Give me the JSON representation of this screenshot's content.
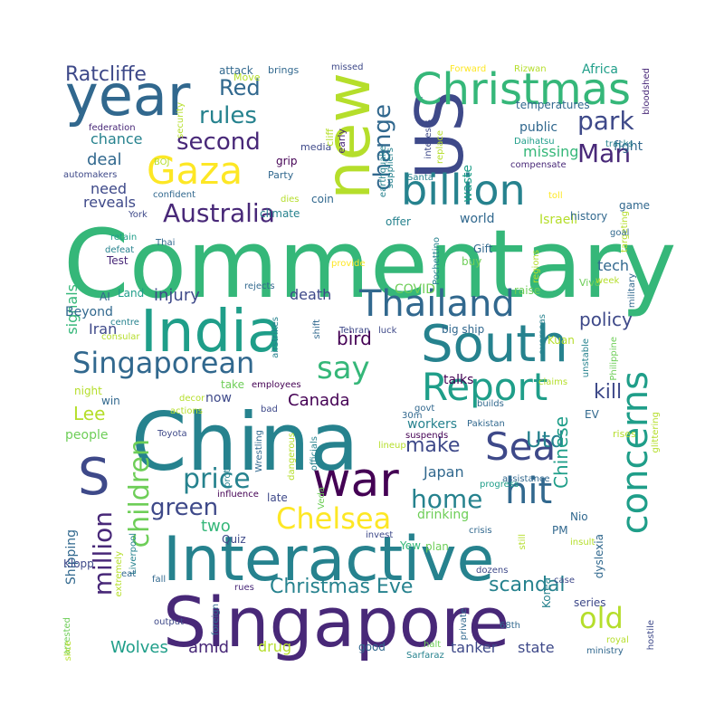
{
  "background": "#ffffff",
  "palette": {
    "d1": "#440154",
    "d2": "#482878",
    "d3": "#3e4989",
    "d4": "#31688e",
    "m1": "#26828e",
    "m2": "#1f9e89",
    "m3": "#35b779",
    "l1": "#6ece58",
    "l2": "#b5de2b",
    "l3": "#fde725"
  },
  "words": [
    {
      "text": "Commentary",
      "color": "#35b779"
    },
    {
      "text": "China",
      "color": "#26828e"
    },
    {
      "text": "Singapore",
      "color": "#482878"
    },
    {
      "text": "Interactive",
      "color": "#26828e"
    },
    {
      "text": "India",
      "color": "#1f9e89"
    },
    {
      "text": "US",
      "color": "#3e4989"
    },
    {
      "text": "new",
      "color": "#b5de2b"
    },
    {
      "text": "year",
      "color": "#31688e"
    },
    {
      "text": "South",
      "color": "#26828e"
    },
    {
      "text": "war",
      "color": "#440154"
    },
    {
      "text": "Christmas",
      "color": "#35b779"
    },
    {
      "text": "billion",
      "color": "#26828e"
    },
    {
      "text": "Report",
      "color": "#1f9e89"
    },
    {
      "text": "Sea",
      "color": "#3e4989"
    },
    {
      "text": "Thailand",
      "color": "#31688e"
    },
    {
      "text": "Gaza",
      "color": "#fde725"
    },
    {
      "text": "concerns",
      "color": "#1f9e89"
    },
    {
      "text": "hit",
      "color": "#31688e"
    },
    {
      "text": "S",
      "color": "#3e4989"
    },
    {
      "text": "say",
      "color": "#35b779"
    },
    {
      "text": "Singaporean",
      "color": "#31688e"
    },
    {
      "text": "Australia",
      "color": "#482878"
    },
    {
      "text": "Chelsea",
      "color": "#fde725"
    },
    {
      "text": "children",
      "color": "#6ece58"
    },
    {
      "text": "price",
      "color": "#26828e"
    },
    {
      "text": "home",
      "color": "#26828e"
    },
    {
      "text": "old",
      "color": "#b5de2b"
    },
    {
      "text": "million",
      "color": "#482878"
    },
    {
      "text": "change",
      "color": "#31688e"
    },
    {
      "text": "second",
      "color": "#482878"
    },
    {
      "text": "Red",
      "color": "#31688e"
    },
    {
      "text": "park",
      "color": "#3e4989"
    },
    {
      "text": "Man",
      "color": "#482878"
    },
    {
      "text": "rules",
      "color": "#26828e"
    },
    {
      "text": "Ratcliffe",
      "color": "#3e4989"
    },
    {
      "text": "Christmas Eve",
      "color": "#26828e"
    },
    {
      "text": "green",
      "color": "#3e4989"
    },
    {
      "text": "Utd",
      "color": "#26828e"
    },
    {
      "text": "make",
      "color": "#3e4989"
    },
    {
      "text": "bird",
      "color": "#440154"
    },
    {
      "text": "Lee",
      "color": "#b5de2b"
    },
    {
      "text": "Chinese",
      "color": "#1f9e89"
    },
    {
      "text": "kill",
      "color": "#3e4989"
    },
    {
      "text": "scandal",
      "color": "#26828e"
    },
    {
      "text": "policy",
      "color": "#3e4989"
    },
    {
      "text": "Japan",
      "color": "#31688e"
    },
    {
      "text": "Wolves",
      "color": "#1f9e89"
    },
    {
      "text": "amid",
      "color": "#482878"
    },
    {
      "text": "tanker",
      "color": "#3e4989"
    },
    {
      "text": "state",
      "color": "#3e4989"
    },
    {
      "text": "signals",
      "color": "#35b779"
    },
    {
      "text": "deal",
      "color": "#31688e"
    },
    {
      "text": "chance",
      "color": "#26828e"
    },
    {
      "text": "injury",
      "color": "#3e4989"
    },
    {
      "text": "death",
      "color": "#3e4989"
    },
    {
      "text": "Canada",
      "color": "#440154"
    },
    {
      "text": "drug",
      "color": "#b5de2b"
    },
    {
      "text": "two",
      "color": "#35b779"
    },
    {
      "text": "Iran",
      "color": "#3e4989"
    },
    {
      "text": "world",
      "color": "#31688e"
    },
    {
      "text": "Israeli",
      "color": "#b5de2b"
    },
    {
      "text": "tech",
      "color": "#31688e"
    },
    {
      "text": "need",
      "color": "#3e4989"
    },
    {
      "text": "reveals",
      "color": "#3e4989"
    },
    {
      "text": "waste",
      "color": "#1f9e89"
    },
    {
      "text": "missing",
      "color": "#35b779"
    },
    {
      "text": "public",
      "color": "#31688e"
    },
    {
      "text": "temperatures",
      "color": "#31688e"
    },
    {
      "text": "fight",
      "color": "#31688e"
    },
    {
      "text": "Africa",
      "color": "#1f9e89"
    },
    {
      "text": "COVID",
      "color": "#6ece58"
    },
    {
      "text": "Beyond",
      "color": "#31688e"
    },
    {
      "text": "night",
      "color": "#b5de2b"
    },
    {
      "text": "people",
      "color": "#6ece58"
    },
    {
      "text": "late",
      "color": "#3e4989"
    },
    {
      "text": "workers",
      "color": "#26828e"
    },
    {
      "text": "Shipping",
      "color": "#31688e"
    },
    {
      "text": "talks",
      "color": "#440154"
    },
    {
      "text": "drinking",
      "color": "#6ece58"
    },
    {
      "text": "now",
      "color": "#3e4989"
    },
    {
      "text": "take",
      "color": "#6ece58"
    },
    {
      "text": "history",
      "color": "#31688e"
    },
    {
      "text": "game",
      "color": "#31688e"
    },
    {
      "text": "Gift",
      "color": "#31688e"
    },
    {
      "text": "buy",
      "color": "#6ece58"
    },
    {
      "text": "raise",
      "color": "#6ece58"
    },
    {
      "text": "Test",
      "color": "#482878"
    },
    {
      "text": "Land",
      "color": "#1f9e89"
    },
    {
      "text": "AI",
      "color": "#31688e"
    },
    {
      "text": "big ship",
      "color": "#31688e"
    },
    {
      "text": "Kuan",
      "color": "#b5de2b"
    },
    {
      "text": "EV",
      "color": "#31688e"
    },
    {
      "text": "Yew",
      "color": "#35b779"
    },
    {
      "text": "PM",
      "color": "#31688e"
    },
    {
      "text": "Nio",
      "color": "#31688e"
    },
    {
      "text": "plan",
      "color": "#6ece58"
    },
    {
      "text": "dyslexia",
      "color": "#31688e"
    },
    {
      "text": "series",
      "color": "#3e4989"
    },
    {
      "text": "Korea",
      "color": "#26828e"
    },
    {
      "text": "good",
      "color": "#31688e"
    },
    {
      "text": "Quiz",
      "color": "#3e4989"
    },
    {
      "text": "Klopp",
      "color": "#3e4989"
    },
    {
      "text": "win",
      "color": "#31688e"
    },
    {
      "text": "Vivo",
      "color": "#6ece58"
    },
    {
      "text": "rises",
      "color": "#b5de2b"
    },
    {
      "text": "coin",
      "color": "#31688e"
    },
    {
      "text": "offer",
      "color": "#26828e"
    },
    {
      "text": "climate",
      "color": "#26828e"
    },
    {
      "text": "Party",
      "color": "#31688e"
    },
    {
      "text": "grip",
      "color": "#440154"
    },
    {
      "text": "media",
      "color": "#3e4989"
    },
    {
      "text": "cliff",
      "color": "#b5de2b"
    },
    {
      "text": "early",
      "color": "#482878"
    },
    {
      "text": "Move",
      "color": "#b5de2b"
    },
    {
      "text": "attack",
      "color": "#31688e"
    },
    {
      "text": "brings",
      "color": "#31688e"
    },
    {
      "text": "missed",
      "color": "#3e4989"
    },
    {
      "text": "Forward",
      "color": "#fde725"
    },
    {
      "text": "Rizwan",
      "color": "#b5de2b"
    },
    {
      "text": "bloodshed",
      "color": "#482878"
    },
    {
      "text": "federation",
      "color": "#482878"
    },
    {
      "text": "security",
      "color": "#b5de2b"
    },
    {
      "text": "earthquake",
      "color": "#26828e"
    },
    {
      "text": "suppliers",
      "color": "#26828e"
    },
    {
      "text": "interests",
      "color": "#3e4989"
    },
    {
      "text": "replace",
      "color": "#b5de2b"
    },
    {
      "text": "Daihatsu",
      "color": "#1f9e89"
    },
    {
      "text": "tracks",
      "color": "#26828e"
    },
    {
      "text": "BOJ",
      "color": "#b5de2b"
    },
    {
      "text": "automakers",
      "color": "#3e4989"
    },
    {
      "text": "confident",
      "color": "#31688e"
    },
    {
      "text": "dies",
      "color": "#b5de2b"
    },
    {
      "text": "Santa",
      "color": "#26828e"
    },
    {
      "text": "toll",
      "color": "#fde725"
    },
    {
      "text": "compensate",
      "color": "#482878"
    },
    {
      "text": "targeting",
      "color": "#b5de2b"
    },
    {
      "text": "goal",
      "color": "#31688e"
    },
    {
      "text": "York",
      "color": "#3e4989"
    },
    {
      "text": "Pochettino",
      "color": "#26828e"
    },
    {
      "text": "retain",
      "color": "#1f9e89"
    },
    {
      "text": "defeat",
      "color": "#26828e"
    },
    {
      "text": "Thai",
      "color": "#31688e"
    },
    {
      "text": "provide",
      "color": "#fde725"
    },
    {
      "text": "regions",
      "color": "#b5de2b"
    },
    {
      "text": "week",
      "color": "#b5de2b"
    },
    {
      "text": "military",
      "color": "#31688e"
    },
    {
      "text": "rejects",
      "color": "#31688e"
    },
    {
      "text": "centre",
      "color": "#26828e"
    },
    {
      "text": "airstrikes",
      "color": "#26828e"
    },
    {
      "text": "shift",
      "color": "#31688e"
    },
    {
      "text": "luck",
      "color": "#3e4989"
    },
    {
      "text": "Tehran",
      "color": "#3e4989"
    },
    {
      "text": "consular",
      "color": "#b5de2b"
    },
    {
      "text": "overseas",
      "color": "#26828e"
    },
    {
      "text": "unstable",
      "color": "#26828e"
    },
    {
      "text": "Philippine",
      "color": "#6ece58"
    },
    {
      "text": "employees",
      "color": "#440154"
    },
    {
      "text": "claims",
      "color": "#b5de2b"
    },
    {
      "text": "decor",
      "color": "#b5de2b"
    },
    {
      "text": "actions",
      "color": "#b5de2b"
    },
    {
      "text": "bad",
      "color": "#3e4989"
    },
    {
      "text": "govt",
      "color": "#31688e"
    },
    {
      "text": "30m",
      "color": "#31688e"
    },
    {
      "text": "builds",
      "color": "#31688e"
    },
    {
      "text": "Toyota",
      "color": "#3e4989"
    },
    {
      "text": "Wrestling",
      "color": "#31688e"
    },
    {
      "text": "Pakistan",
      "color": "#31688e"
    },
    {
      "text": "protect",
      "color": "#26828e"
    },
    {
      "text": "dangerous",
      "color": "#b5de2b"
    },
    {
      "text": "officials",
      "color": "#26828e"
    },
    {
      "text": "lineup",
      "color": "#b5de2b"
    },
    {
      "text": "suspends",
      "color": "#440154"
    },
    {
      "text": "Veda",
      "color": "#6ece58"
    },
    {
      "text": "glittering",
      "color": "#b5de2b"
    },
    {
      "text": "assistance",
      "color": "#31688e"
    },
    {
      "text": "influence",
      "color": "#440154"
    },
    {
      "text": "progress",
      "color": "#1f9e89"
    },
    {
      "text": "Liverpool",
      "color": "#26828e"
    },
    {
      "text": "invest",
      "color": "#3e4989"
    },
    {
      "text": "crisis",
      "color": "#31688e"
    },
    {
      "text": "still",
      "color": "#b5de2b"
    },
    {
      "text": "insult",
      "color": "#b5de2b"
    },
    {
      "text": "extremely",
      "color": "#b5de2b"
    },
    {
      "text": "eat",
      "color": "#31688e"
    },
    {
      "text": "dozens",
      "color": "#3e4989"
    },
    {
      "text": "fall",
      "color": "#31688e"
    },
    {
      "text": "rues",
      "color": "#482878"
    },
    {
      "text": "case",
      "color": "#3e4989"
    },
    {
      "text": "arrested",
      "color": "#6ece58"
    },
    {
      "text": "output",
      "color": "#3e4989"
    },
    {
      "text": "foreign",
      "color": "#31688e"
    },
    {
      "text": "private",
      "color": "#31688e"
    },
    {
      "text": "68th",
      "color": "#31688e"
    },
    {
      "text": "hostile",
      "color": "#3e4989"
    },
    {
      "text": "royal",
      "color": "#b5de2b"
    },
    {
      "text": "slice",
      "color": "#b5de2b"
    },
    {
      "text": "halt",
      "color": "#6ece58"
    },
    {
      "text": "Sarfaraz",
      "color": "#26828e"
    },
    {
      "text": "ministry",
      "color": "#31688e"
    }
  ]
}
